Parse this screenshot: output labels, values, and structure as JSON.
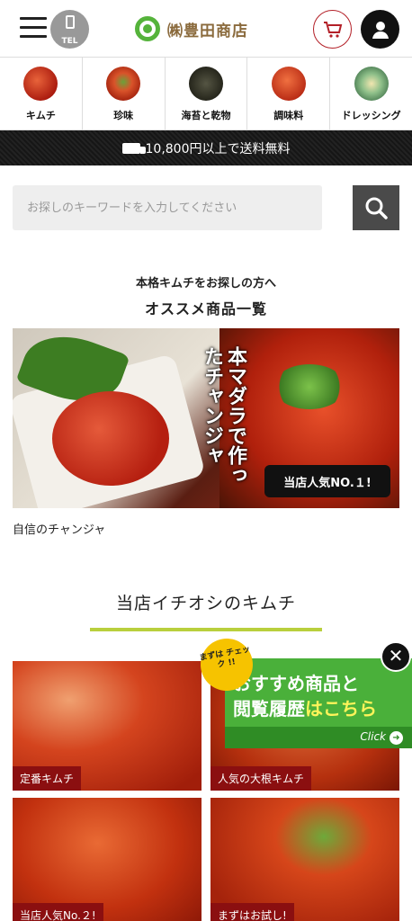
{
  "header": {
    "tel_label": "TEL",
    "logo_text": "㈱豊田商店",
    "brand_color": "#55b33b"
  },
  "categories": [
    {
      "label": "キムチ",
      "color": "#c1271a"
    },
    {
      "label": "珍味",
      "color": "#cf3b1d"
    },
    {
      "label": "海苔と乾物",
      "color": "#2e2e22"
    },
    {
      "label": "調味料",
      "color": "#d64626"
    },
    {
      "label": "ドレッシング",
      "color": "#6f9f6a"
    }
  ],
  "shipping_banner": "10,800円以上で送料無料",
  "search": {
    "placeholder": "お探しのキーワードを入力してください"
  },
  "recommend": {
    "subtitle": "本格キムチをお探しの方へ",
    "title": "オススメ商品一覧",
    "banner_caption_vertical": "本マダラで作ったチャンジャ",
    "banner_badge": "当店人気NO.１!",
    "banner_caption": "自信のチャンジャ"
  },
  "section": {
    "title": "当店イチオシのキムチ",
    "underline_color": "#b9cf3d"
  },
  "products": [
    {
      "label": "定番キムチ"
    },
    {
      "label": "人気の大根キムチ"
    },
    {
      "label": "当店人気No.２!"
    },
    {
      "label": "まずはお試し!"
    }
  ],
  "popup": {
    "check_text": "まずは チェック !!",
    "line1_prefix": "おすすめ商品と",
    "line2_prefix": "閲覧履歴",
    "line2_mid": "は",
    "line2_suffix": "こちら",
    "click_label": "Click",
    "close_symbol": "✕"
  }
}
